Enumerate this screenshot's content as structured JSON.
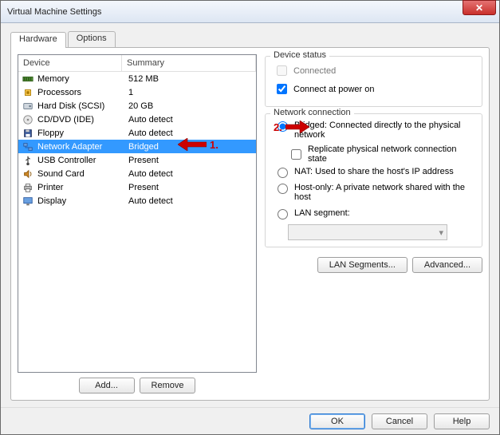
{
  "window": {
    "title": "Virtual Machine Settings"
  },
  "tabs": {
    "hardware": "Hardware",
    "options": "Options"
  },
  "device_list": {
    "col_device": "Device",
    "col_summary": "Summary",
    "rows": [
      {
        "name": "Memory",
        "summary": "512 MB",
        "icon": "memory"
      },
      {
        "name": "Processors",
        "summary": "1",
        "icon": "cpu"
      },
      {
        "name": "Hard Disk (SCSI)",
        "summary": "20 GB",
        "icon": "disk"
      },
      {
        "name": "CD/DVD (IDE)",
        "summary": "Auto detect",
        "icon": "cd"
      },
      {
        "name": "Floppy",
        "summary": "Auto detect",
        "icon": "floppy"
      },
      {
        "name": "Network Adapter",
        "summary": "Bridged",
        "icon": "network",
        "selected": true
      },
      {
        "name": "USB Controller",
        "summary": "Present",
        "icon": "usb"
      },
      {
        "name": "Sound Card",
        "summary": "Auto detect",
        "icon": "sound"
      },
      {
        "name": "Printer",
        "summary": "Present",
        "icon": "printer"
      },
      {
        "name": "Display",
        "summary": "Auto detect",
        "icon": "display"
      }
    ],
    "add_button": "Add...",
    "remove_button": "Remove"
  },
  "device_status": {
    "legend": "Device status",
    "connected_label": "Connected",
    "connected_checked": false,
    "connect_power_label": "Connect at power on",
    "connect_power_checked": true
  },
  "net_conn": {
    "legend": "Network connection",
    "bridged": "Bridged: Connected directly to the physical network",
    "replicate": "Replicate physical network connection state",
    "nat": "NAT: Used to share the host's IP address",
    "hostonly": "Host-only: A private network shared with the host",
    "lan_segment": "LAN segment:",
    "selected": "bridged",
    "lan_segments_btn": "LAN Segments...",
    "advanced_btn": "Advanced..."
  },
  "dialog_buttons": {
    "ok": "OK",
    "cancel": "Cancel",
    "help": "Help"
  },
  "annotations": {
    "one": "1.",
    "two": "2."
  }
}
